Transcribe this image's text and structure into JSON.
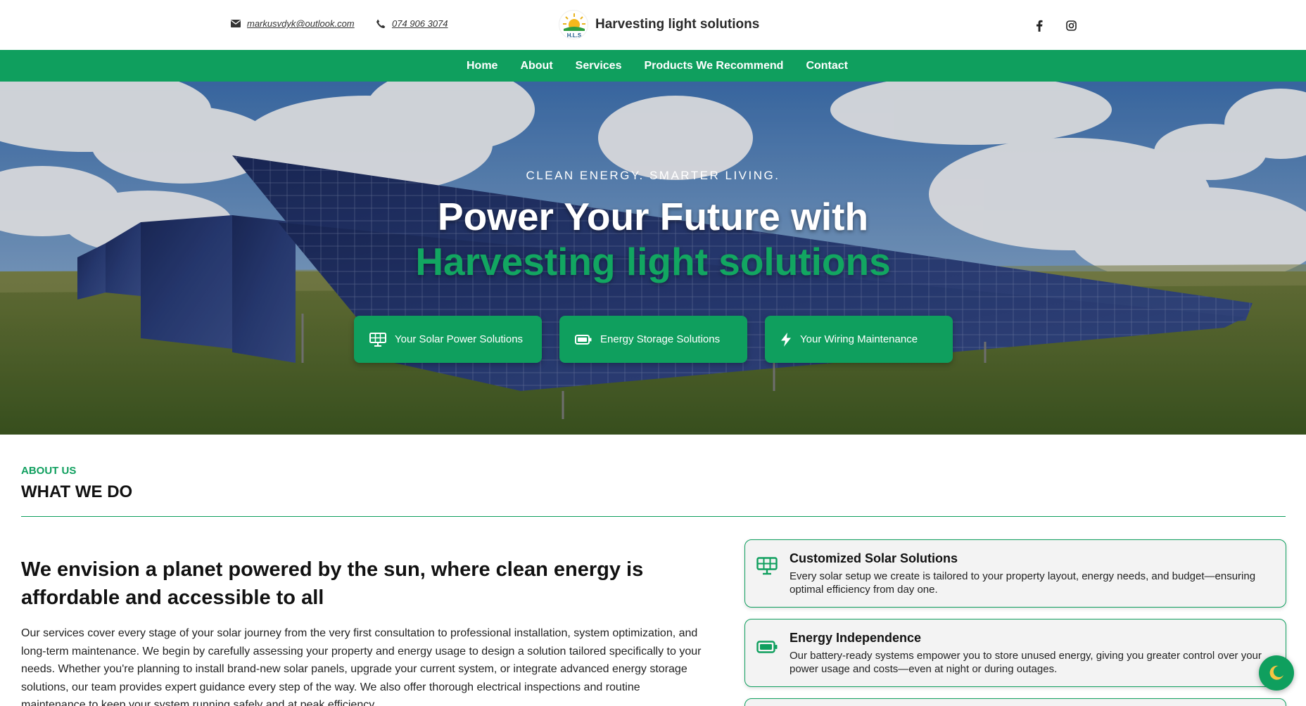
{
  "header": {
    "email": "markusvdyk@outlook.com",
    "phone": "074 906 3074",
    "brand_name": "Harvesting light solutions",
    "logo_text": "H.L.S",
    "social_icons": [
      "facebook-icon",
      "instagram-icon"
    ]
  },
  "nav": {
    "items": [
      {
        "label": "Home"
      },
      {
        "label": "About"
      },
      {
        "label": "Services"
      },
      {
        "label": "Products We Recommend"
      },
      {
        "label": "Contact"
      }
    ]
  },
  "hero": {
    "tagline": "CLEAN ENERGY. SMARTER LIVING.",
    "heading_line1": "Power Your Future with",
    "heading_line2": "Harvesting light solutions",
    "buttons": [
      {
        "label": "Your Solar Power Solutions",
        "icon": "solar-panel-icon"
      },
      {
        "label": "Energy Storage Solutions",
        "icon": "battery-icon"
      },
      {
        "label": "Your Wiring Maintenance",
        "icon": "lightning-icon"
      }
    ]
  },
  "about": {
    "kicker": "ABOUT US",
    "title": "WHAT WE DO",
    "heading": "We envision a planet powered by the sun, where clean energy is affordable and accessible to all",
    "paragraph": "Our services cover every stage of your solar journey from the very first consultation to professional installation, system optimization, and long-term maintenance. We begin by carefully assessing your property and energy usage to design a solution tailored specifically to your needs. Whether you're planning to install brand-new solar panels, upgrade your current system, or integrate advanced energy storage solutions, our team provides expert guidance every step of the way. We also offer thorough electrical inspections and routine maintenance to keep your system running safely and at peak efficiency.",
    "cards": [
      {
        "title": "Customized Solar Solutions",
        "desc": "Every solar setup we create is tailored to your property layout, energy needs, and budget—ensuring optimal efficiency from day one.",
        "icon": "solar-panel-icon"
      },
      {
        "title": "Energy Independence",
        "desc": "Our battery-ready systems empower you to store unused energy, giving you greater control over your power usage and costs—even at night or during outages.",
        "icon": "battery-icon"
      }
    ]
  },
  "colors": {
    "brand_green": "#0f9f5e",
    "hero_green_text": "#12a661"
  },
  "theme_toggle": {
    "icon": "moon-icon"
  }
}
